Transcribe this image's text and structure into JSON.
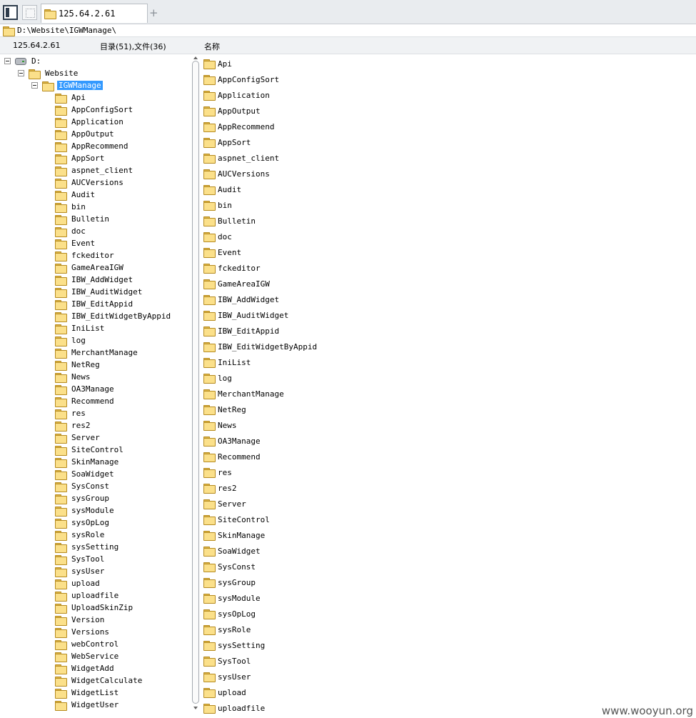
{
  "tab": {
    "title": "125.64.2.61"
  },
  "address": {
    "path": "D:\\Website\\IGWManage\\"
  },
  "info": {
    "host": "125.64.2.61",
    "counts": "目录(51),文件(36)",
    "name_header": "名称"
  },
  "tree": {
    "drive": "D:",
    "website": "Website",
    "selected": "IGWManage",
    "children": [
      "Api",
      "AppConfigSort",
      "Application",
      "AppOutput",
      "AppRecommend",
      "AppSort",
      "aspnet_client",
      "AUCVersions",
      "Audit",
      "bin",
      "Bulletin",
      "doc",
      "Event",
      "fckeditor",
      "GameAreaIGW",
      "IBW_AddWidget",
      "IBW_AuditWidget",
      "IBW_EditAppid",
      "IBW_EditWidgetByAppid",
      "IniList",
      "log",
      "MerchantManage",
      "NetReg",
      "News",
      "OA3Manage",
      "Recommend",
      "res",
      "res2",
      "Server",
      "SiteControl",
      "SkinManage",
      "SoaWidget",
      "SysConst",
      "sysGroup",
      "sysModule",
      "sysOpLog",
      "sysRole",
      "sysSetting",
      "SysTool",
      "sysUser",
      "upload",
      "uploadfile",
      "UploadSkinZip",
      "Version",
      "Versions",
      "webControl",
      "WebService",
      "WidgetAdd",
      "WidgetCalculate",
      "WidgetList",
      "WidgetUser"
    ]
  },
  "list": {
    "items": [
      "Api",
      "AppConfigSort",
      "Application",
      "AppOutput",
      "AppRecommend",
      "AppSort",
      "aspnet_client",
      "AUCVersions",
      "Audit",
      "bin",
      "Bulletin",
      "doc",
      "Event",
      "fckeditor",
      "GameAreaIGW",
      "IBW_AddWidget",
      "IBW_AuditWidget",
      "IBW_EditAppid",
      "IBW_EditWidgetByAppid",
      "IniList",
      "log",
      "MerchantManage",
      "NetReg",
      "News",
      "OA3Manage",
      "Recommend",
      "res",
      "res2",
      "Server",
      "SiteControl",
      "SkinManage",
      "SoaWidget",
      "SysConst",
      "sysGroup",
      "sysModule",
      "sysOpLog",
      "sysRole",
      "sysSetting",
      "SysTool",
      "sysUser",
      "upload",
      "uploadfile"
    ]
  },
  "watermark": "www.wooyun.org"
}
